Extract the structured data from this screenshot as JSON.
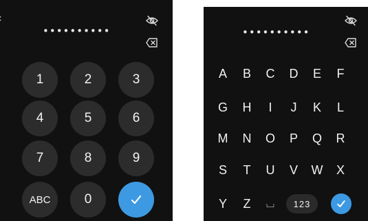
{
  "numeric_pad": {
    "password_mask": "••••••••••",
    "back_glyph": "‹",
    "keys": [
      "1",
      "2",
      "3",
      "4",
      "5",
      "6",
      "7",
      "8",
      "9",
      "ABC",
      "0"
    ],
    "confirm_icon": "checkmark-icon",
    "eye_icon": "eye-slash-icon",
    "backspace_icon": "backspace-icon"
  },
  "alpha_pad": {
    "password_mask": "••••••••••",
    "keys": [
      "A",
      "B",
      "C",
      "D",
      "E",
      "F",
      "G",
      "H",
      "I",
      "J",
      "K",
      "L",
      "M",
      "N",
      "O",
      "P",
      "Q",
      "R",
      "S",
      "T",
      "U",
      "V",
      "W",
      "X",
      "Y",
      "Z"
    ],
    "space_label": "⌴",
    "mode_label": "123",
    "confirm_icon": "checkmark-icon",
    "eye_icon": "eye-slash-icon",
    "backspace_icon": "backspace-icon"
  },
  "colors": {
    "screen_bg": "#111111",
    "key_bg": "#2c2c2c",
    "accent": "#3d9ae2",
    "text": "#f2f2f2"
  }
}
